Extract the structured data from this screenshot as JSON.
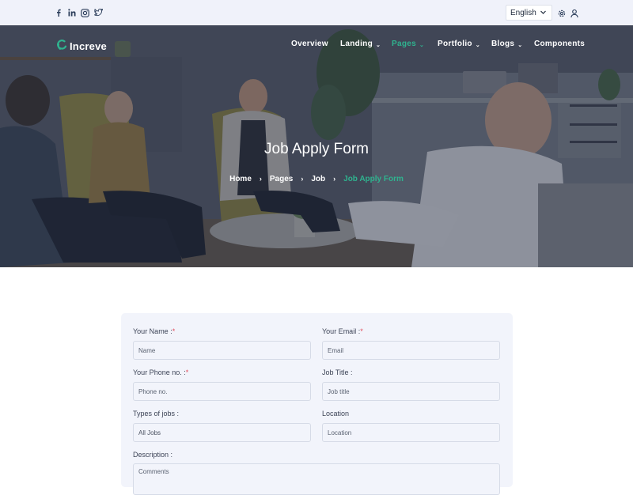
{
  "topbar": {
    "social_icons": [
      "facebook-icon",
      "linkedin-icon",
      "instagram-icon",
      "twitter-icon"
    ],
    "language": "English",
    "icons": [
      "settings-icon",
      "user-icon"
    ]
  },
  "header": {
    "brand": "Increve",
    "nav": [
      {
        "label": "Overview",
        "dropdown": false,
        "active": false
      },
      {
        "label": "Landing",
        "dropdown": true,
        "active": false
      },
      {
        "label": "Pages",
        "dropdown": true,
        "active": true
      },
      {
        "label": "Portfolio",
        "dropdown": true,
        "active": false
      },
      {
        "label": "Blogs",
        "dropdown": true,
        "active": false
      },
      {
        "label": "Components",
        "dropdown": false,
        "active": false
      }
    ]
  },
  "hero": {
    "title": "Job Apply Form",
    "breadcrumb": [
      "Home",
      "Pages",
      "Job",
      "Job Apply Form"
    ]
  },
  "form": {
    "name": {
      "label": "Your Name :",
      "required": "*",
      "placeholder": "Name"
    },
    "email": {
      "label": "Your Email :",
      "required": "*",
      "placeholder": "Email"
    },
    "phone": {
      "label": "Your Phone no. :",
      "required": "*",
      "placeholder": "Phone no."
    },
    "job_title": {
      "label": "Job Title :",
      "placeholder": "Job title"
    },
    "job_type": {
      "label": "Types of jobs :",
      "value": "All Jobs"
    },
    "location": {
      "label": "Location",
      "placeholder": "Location"
    },
    "description": {
      "label": "Description :",
      "placeholder": "Comments"
    }
  },
  "colors": {
    "accent": "#2fb38f",
    "required": "#e04a5a",
    "topbar": "#f0f2fa",
    "card": "#f2f4fb"
  }
}
